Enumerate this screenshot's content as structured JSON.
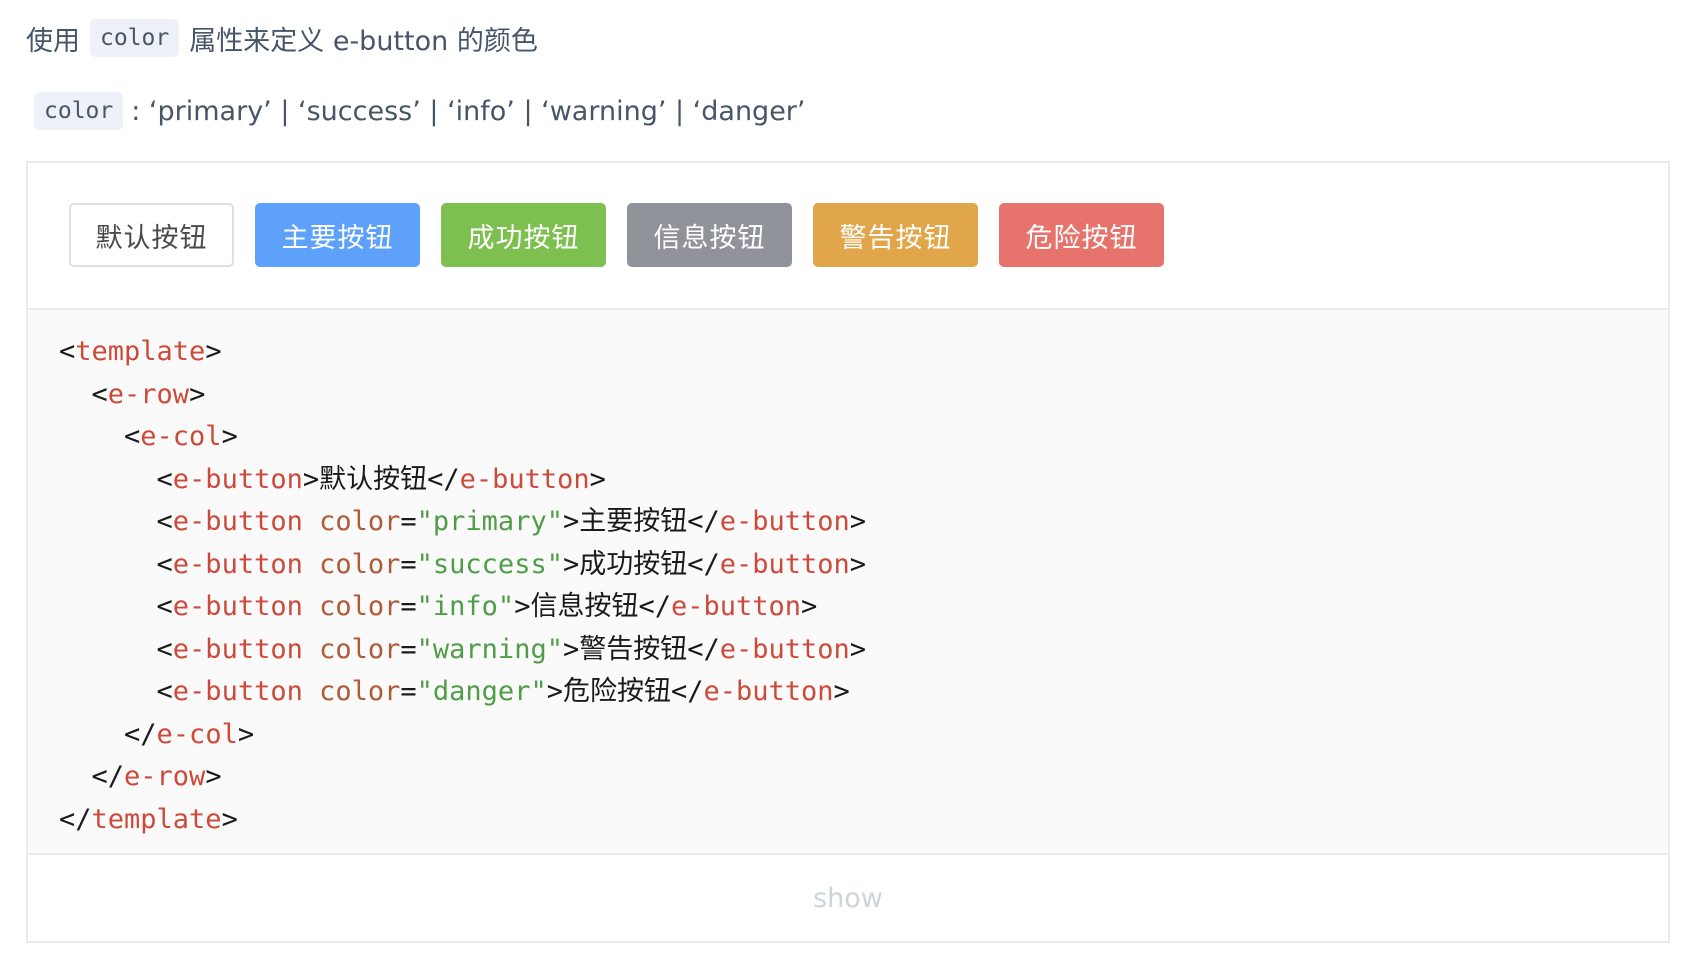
{
  "description": {
    "prefix": "使用",
    "code": "color",
    "suffix": "属性来定义 e-button 的颜色"
  },
  "prop_line": {
    "code": "color",
    "values": ": ‘primary’ | ‘success’ | ‘info’ | ‘warning’ | ‘danger’"
  },
  "buttons": [
    {
      "label": "默认按钮"
    },
    {
      "label": "主要按钮"
    },
    {
      "label": "成功按钮"
    },
    {
      "label": "信息按钮"
    },
    {
      "label": "警告按钮"
    },
    {
      "label": "危险按钮"
    }
  ],
  "colors": {
    "primary": "#5ea1fa",
    "success": "#7ec050",
    "info": "#909399",
    "warning": "#e1a54a",
    "danger": "#e7736d",
    "tag": "#cd4a3b",
    "attr": "#b05a38",
    "string": "#4f9d47"
  },
  "code_lines": [
    [
      {
        "t": "pt",
        "v": "<"
      },
      {
        "t": "tg",
        "v": "template"
      },
      {
        "t": "pt",
        "v": ">"
      }
    ],
    [
      {
        "t": "pt",
        "v": "  <"
      },
      {
        "t": "tg",
        "v": "e-row"
      },
      {
        "t": "pt",
        "v": ">"
      }
    ],
    [
      {
        "t": "pt",
        "v": "    <"
      },
      {
        "t": "tg",
        "v": "e-col"
      },
      {
        "t": "pt",
        "v": ">"
      }
    ],
    [
      {
        "t": "pt",
        "v": "      <"
      },
      {
        "t": "tg",
        "v": "e-button"
      },
      {
        "t": "pt",
        "v": ">"
      },
      {
        "t": "tx",
        "v": "默认按钮"
      },
      {
        "t": "pt",
        "v": "</"
      },
      {
        "t": "tg",
        "v": "e-button"
      },
      {
        "t": "pt",
        "v": ">"
      }
    ],
    [
      {
        "t": "pt",
        "v": "      <"
      },
      {
        "t": "tg",
        "v": "e-button"
      },
      {
        "t": "pt",
        "v": " "
      },
      {
        "t": "at",
        "v": "color"
      },
      {
        "t": "pt",
        "v": "="
      },
      {
        "t": "st",
        "v": "\"primary\""
      },
      {
        "t": "pt",
        "v": ">"
      },
      {
        "t": "tx",
        "v": "主要按钮"
      },
      {
        "t": "pt",
        "v": "</"
      },
      {
        "t": "tg",
        "v": "e-button"
      },
      {
        "t": "pt",
        "v": ">"
      }
    ],
    [
      {
        "t": "pt",
        "v": "      <"
      },
      {
        "t": "tg",
        "v": "e-button"
      },
      {
        "t": "pt",
        "v": " "
      },
      {
        "t": "at",
        "v": "color"
      },
      {
        "t": "pt",
        "v": "="
      },
      {
        "t": "st",
        "v": "\"success\""
      },
      {
        "t": "pt",
        "v": ">"
      },
      {
        "t": "tx",
        "v": "成功按钮"
      },
      {
        "t": "pt",
        "v": "</"
      },
      {
        "t": "tg",
        "v": "e-button"
      },
      {
        "t": "pt",
        "v": ">"
      }
    ],
    [
      {
        "t": "pt",
        "v": "      <"
      },
      {
        "t": "tg",
        "v": "e-button"
      },
      {
        "t": "pt",
        "v": " "
      },
      {
        "t": "at",
        "v": "color"
      },
      {
        "t": "pt",
        "v": "="
      },
      {
        "t": "st",
        "v": "\"info\""
      },
      {
        "t": "pt",
        "v": ">"
      },
      {
        "t": "tx",
        "v": "信息按钮"
      },
      {
        "t": "pt",
        "v": "</"
      },
      {
        "t": "tg",
        "v": "e-button"
      },
      {
        "t": "pt",
        "v": ">"
      }
    ],
    [
      {
        "t": "pt",
        "v": "      <"
      },
      {
        "t": "tg",
        "v": "e-button"
      },
      {
        "t": "pt",
        "v": " "
      },
      {
        "t": "at",
        "v": "color"
      },
      {
        "t": "pt",
        "v": "="
      },
      {
        "t": "st",
        "v": "\"warning\""
      },
      {
        "t": "pt",
        "v": ">"
      },
      {
        "t": "tx",
        "v": "警告按钮"
      },
      {
        "t": "pt",
        "v": "</"
      },
      {
        "t": "tg",
        "v": "e-button"
      },
      {
        "t": "pt",
        "v": ">"
      }
    ],
    [
      {
        "t": "pt",
        "v": "      <"
      },
      {
        "t": "tg",
        "v": "e-button"
      },
      {
        "t": "pt",
        "v": " "
      },
      {
        "t": "at",
        "v": "color"
      },
      {
        "t": "pt",
        "v": "="
      },
      {
        "t": "st",
        "v": "\"danger\""
      },
      {
        "t": "pt",
        "v": ">"
      },
      {
        "t": "tx",
        "v": "危险按钮"
      },
      {
        "t": "pt",
        "v": "</"
      },
      {
        "t": "tg",
        "v": "e-button"
      },
      {
        "t": "pt",
        "v": ">"
      }
    ],
    [
      {
        "t": "pt",
        "v": "    </"
      },
      {
        "t": "tg",
        "v": "e-col"
      },
      {
        "t": "pt",
        "v": ">"
      }
    ],
    [
      {
        "t": "pt",
        "v": "  </"
      },
      {
        "t": "tg",
        "v": "e-row"
      },
      {
        "t": "pt",
        "v": ">"
      }
    ],
    [
      {
        "t": "pt",
        "v": "</"
      },
      {
        "t": "tg",
        "v": "template"
      },
      {
        "t": "pt",
        "v": ">"
      }
    ]
  ],
  "show_label": "show"
}
